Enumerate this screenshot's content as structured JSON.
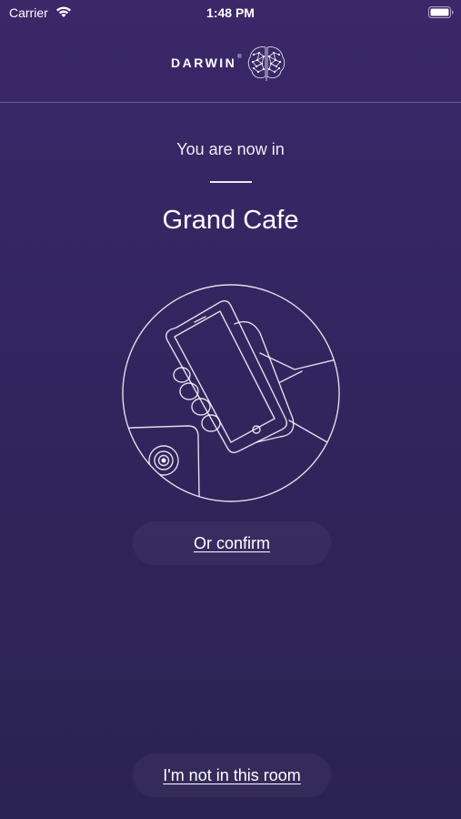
{
  "status_bar": {
    "carrier": "Carrier",
    "time": "1:48 PM"
  },
  "header": {
    "logo_text": "DARWIN",
    "logo_mark": "®"
  },
  "main": {
    "subtitle": "You are now in",
    "room_name": "Grand Cafe",
    "illustration": "hand-phone-tap-icon"
  },
  "actions": {
    "confirm_label": "Or confirm",
    "not_in_room_label": "I'm not in this room"
  },
  "colors": {
    "background_top": "#3c2769",
    "background_bottom": "#2b2353",
    "text": "#ffffff"
  }
}
